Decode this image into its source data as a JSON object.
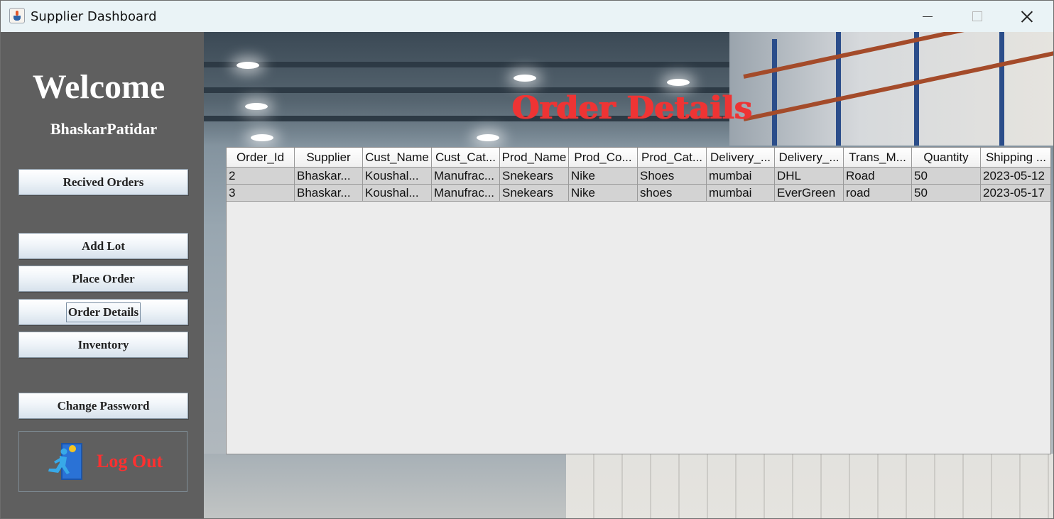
{
  "window": {
    "title": "Supplier Dashboard",
    "controls": {
      "minimize": "minimize-icon",
      "maximize": "maximize-icon",
      "close": "close-icon"
    }
  },
  "sidebar": {
    "welcome": "Welcome",
    "username": "BhaskarPatidar",
    "buttons": {
      "received_orders": "Recived Orders",
      "add_lot": "Add Lot",
      "place_order": "Place Order",
      "order_details": "Order Details",
      "inventory": "Inventory",
      "change_password": "Change Password"
    },
    "logout": {
      "label": "Log Out",
      "icon": "exit-door-runner-icon"
    }
  },
  "main": {
    "heading": "Order Details",
    "heading_color": "#ee3434",
    "table": {
      "columns": [
        "Order_Id",
        "Supplier",
        "Cust_Name",
        "Cust_Cat...",
        "Prod_Name",
        "Prod_Co...",
        "Prod_Cat...",
        "Delivery_...",
        "Delivery_...",
        "Trans_M...",
        "Quantity",
        "Shipping ..."
      ],
      "rows": [
        [
          "2",
          "Bhaskar...",
          "Koushal...",
          "Manufrac...",
          "Snekears",
          "Nike",
          "Shoes",
          "mumbai",
          "DHL",
          "Road",
          "50",
          "2023-05-12"
        ],
        [
          "3",
          "Bhaskar...",
          "Koushal...",
          "Manufrac...",
          "Snekears",
          "Nike",
          "shoes",
          "mumbai",
          "EverGreen",
          "road",
          "50",
          "2023-05-17"
        ]
      ]
    }
  },
  "colors": {
    "sidebar_bg": "#5f5f5f",
    "logout_text": "#ff3030",
    "row_bg": "#d3d3d3"
  }
}
